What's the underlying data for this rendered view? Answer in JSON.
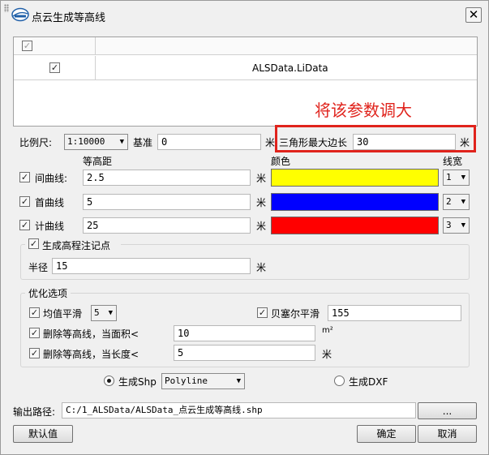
{
  "window": {
    "title": "点云生成等高线",
    "close_glyph": "✕"
  },
  "table": {
    "header_checked": true,
    "rows": [
      {
        "checked": true,
        "name": "ALSData.LiData"
      }
    ]
  },
  "annotation": {
    "text": "将该参数调大",
    "color": "#e0231c"
  },
  "scale": {
    "label": "比例尺:",
    "value": "1:10000",
    "base_label": "基准",
    "base_value": "0",
    "unit": "米"
  },
  "triangle": {
    "label": "三角形最大边长",
    "value": "30",
    "unit": "米"
  },
  "headers": {
    "interval": "等高距",
    "color": "颜色",
    "width": "线宽"
  },
  "contours": [
    {
      "label": "间曲线:",
      "checked": true,
      "interval": "2.5",
      "unit": "米",
      "color": "#ffff00",
      "width": "1"
    },
    {
      "label": "首曲线",
      "checked": true,
      "interval": "5",
      "unit": "米",
      "color": "#0000ff",
      "width": "2"
    },
    {
      "label": "计曲线",
      "checked": true,
      "interval": "25",
      "unit": "米",
      "color": "#ff0000",
      "width": "3"
    }
  ],
  "elevation": {
    "label": "生成高程注记点",
    "checked": true,
    "radius_label": "半径",
    "radius_value": "15",
    "unit": "米"
  },
  "optimize": {
    "title": "优化选项",
    "mean_smooth": {
      "label": "均值平滑",
      "checked": true,
      "value": "5"
    },
    "bezier": {
      "label": "贝塞尔平滑",
      "checked": true,
      "value": "155"
    },
    "delete_area": {
      "label": "删除等高线，当面积<",
      "checked": true,
      "value": "10",
      "unit": "m²"
    },
    "delete_length": {
      "label": "删除等高线，当长度<",
      "checked": true,
      "value": "5",
      "unit": "米"
    }
  },
  "output_type": {
    "shp_label": "生成Shp",
    "shp_selected": true,
    "shp_geometry": "Polyline",
    "dxf_label": "生成DXF",
    "dxf_selected": false
  },
  "output": {
    "label": "输出路径:",
    "path": "C:/1_ALSData/ALSData_点云生成等高线.shp",
    "browse": "..."
  },
  "buttons": {
    "default": "默认值",
    "ok": "确定",
    "cancel": "取消"
  }
}
